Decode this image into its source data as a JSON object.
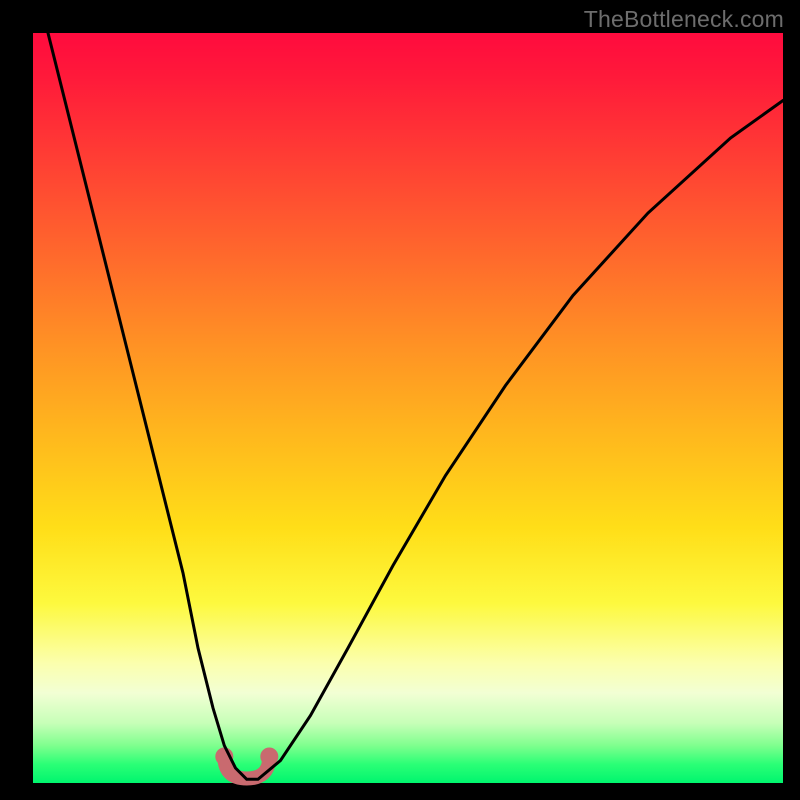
{
  "watermark": "TheBottleneck.com",
  "colors": {
    "frame": "#000000",
    "gradient_top": "#ff0b3e",
    "gradient_mid": "#ffde18",
    "gradient_bottom": "#00f56e",
    "curve": "#000000",
    "flat_segment": "#c96a6f"
  },
  "chart_data": {
    "type": "line",
    "title": "",
    "xlabel": "",
    "ylabel": "",
    "xlim": [
      0,
      100
    ],
    "ylim": [
      0,
      100
    ],
    "series": [
      {
        "name": "bottleneck-curve",
        "x": [
          2,
          5,
          8,
          11,
          14,
          17,
          20,
          22,
          24,
          25.5,
          27,
          28.5,
          30,
          33,
          37,
          42,
          48,
          55,
          63,
          72,
          82,
          93,
          100
        ],
        "y": [
          100,
          88,
          76,
          64,
          52,
          40,
          28,
          18,
          10,
          5,
          2,
          0.5,
          0.5,
          3,
          9,
          18,
          29,
          41,
          53,
          65,
          76,
          86,
          91
        ]
      }
    ],
    "flat_region": {
      "x_start": 25.5,
      "x_end": 31.5,
      "y": 0.6
    }
  }
}
